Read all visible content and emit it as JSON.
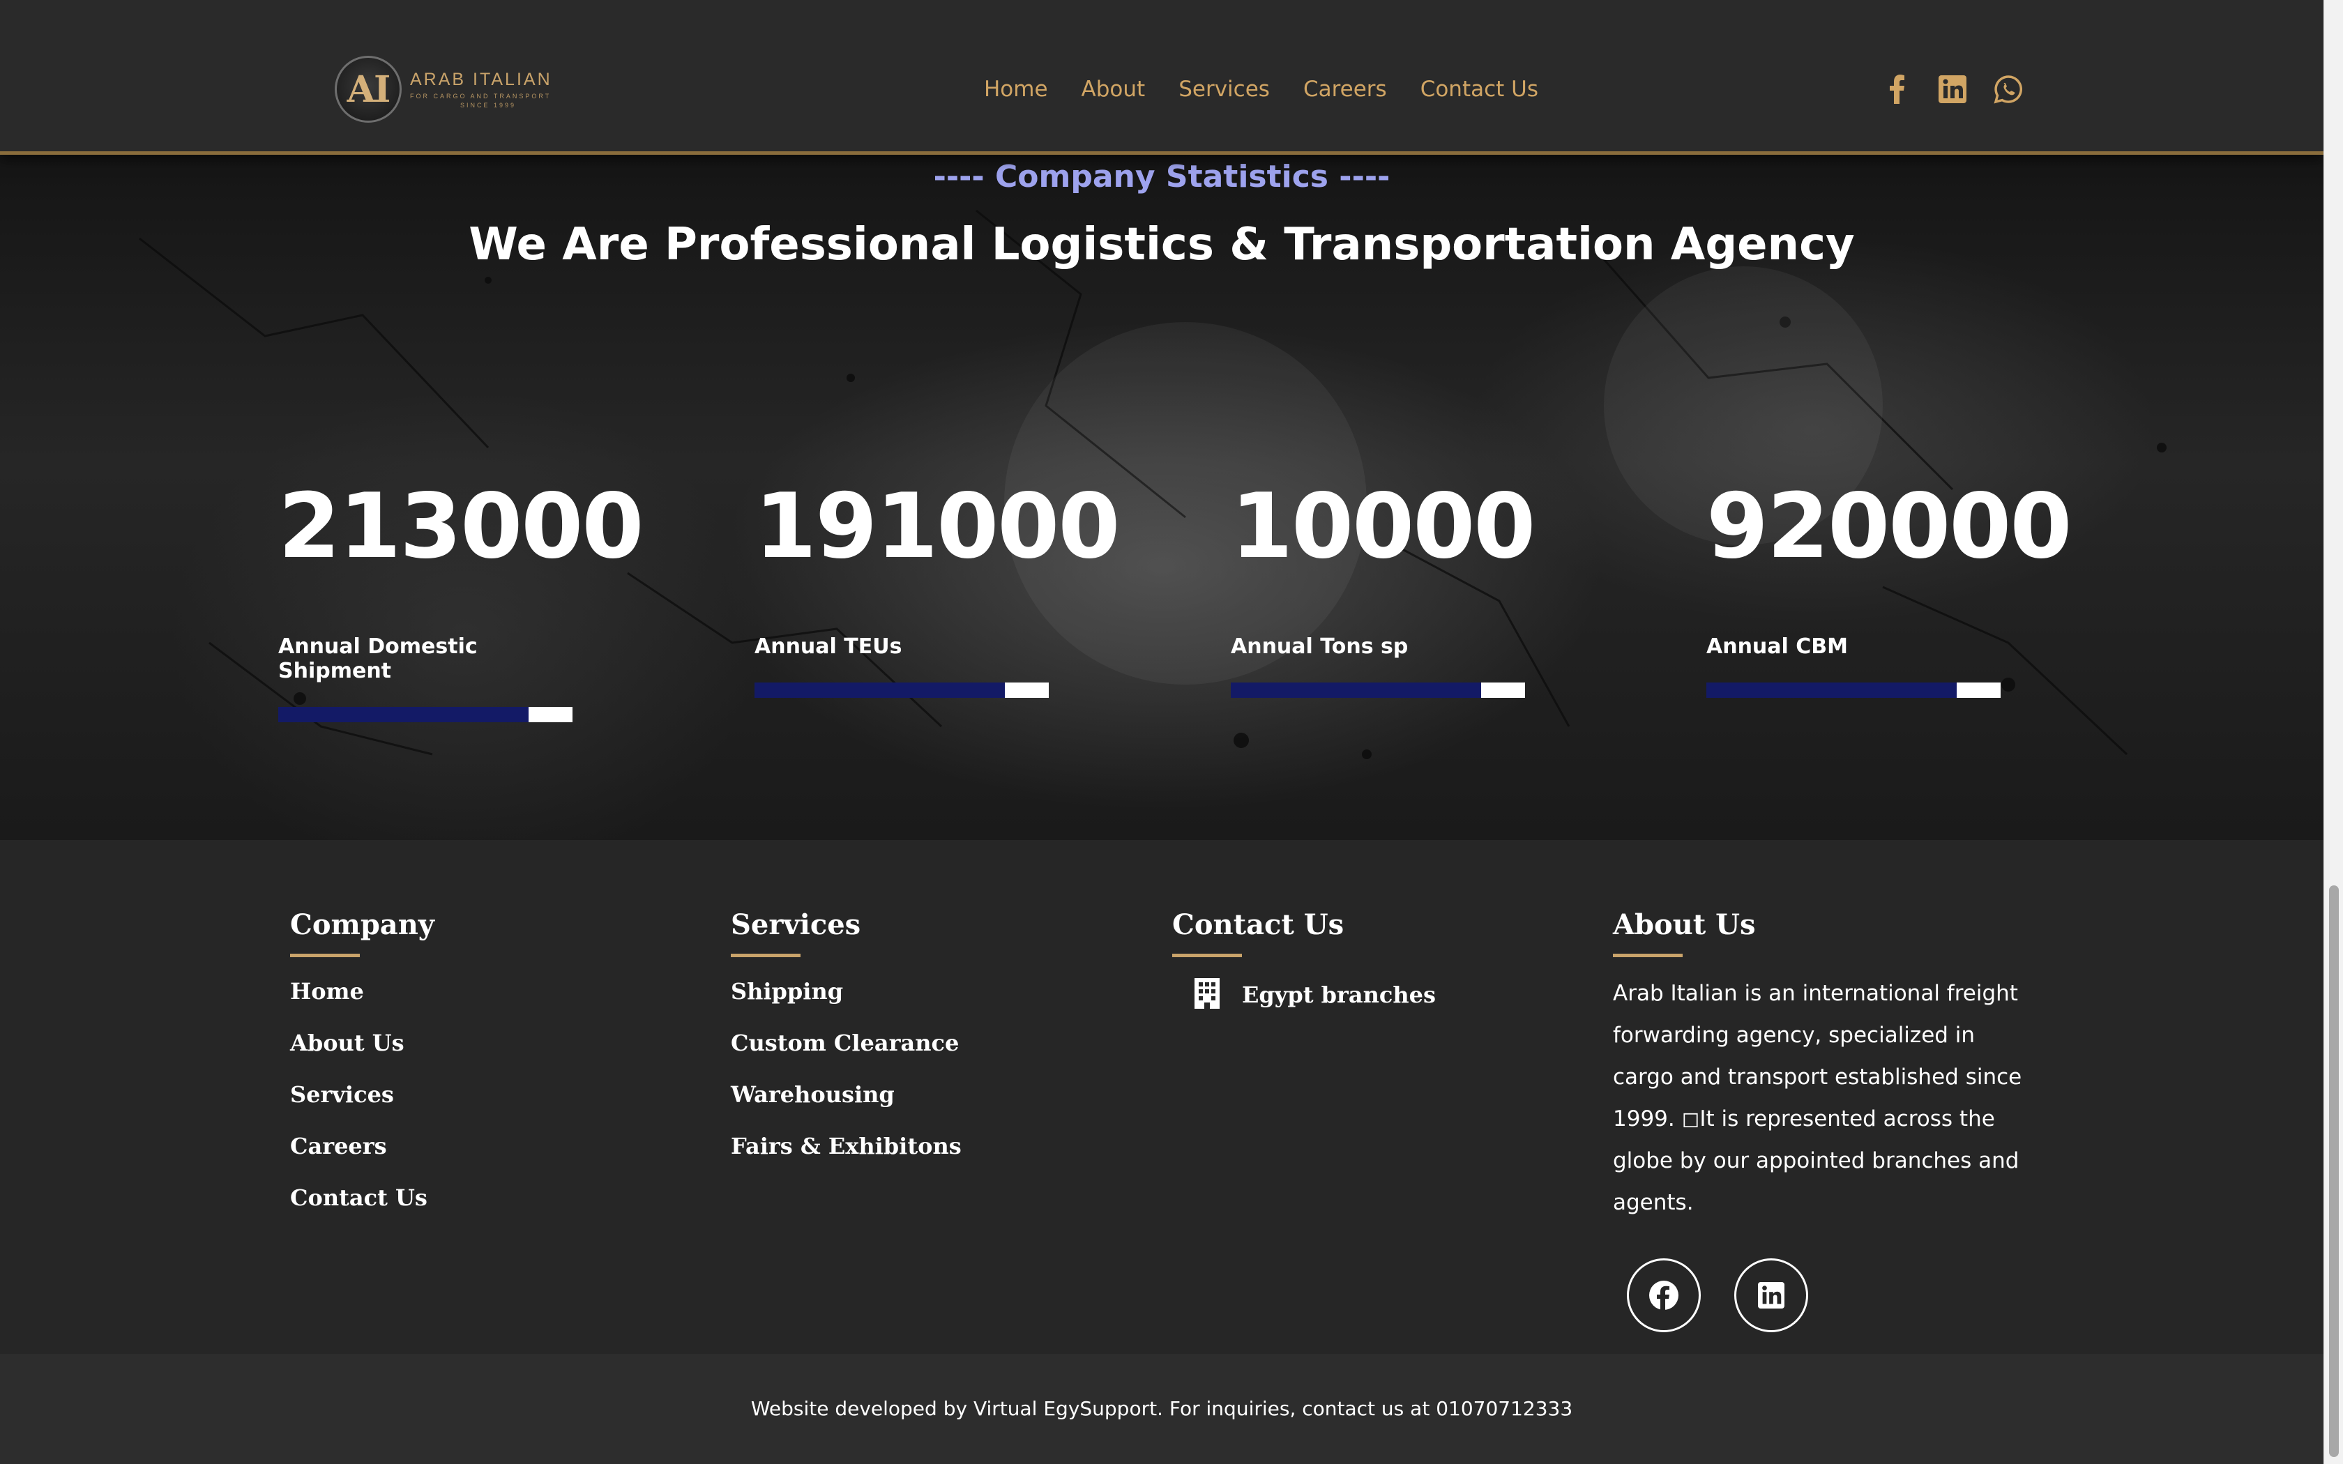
{
  "brand": {
    "logo_mark": "AI",
    "name": "ARAB ITALIAN",
    "tagline": "FOR CARGO AND TRANSPORT",
    "since": "SINCE 1999"
  },
  "nav": {
    "items": [
      "Home",
      "About",
      "Services",
      "Careers",
      "Contact Us"
    ]
  },
  "header_socials": [
    "facebook-icon",
    "linkedin-icon",
    "whatsapp-icon"
  ],
  "stats_section": {
    "kicker": "---- Company Statistics ----",
    "title": "We Are Professional Logistics & Transportation Agency",
    "items": [
      {
        "value": "213000",
        "label": "Annual Domestic Shipment",
        "progress": 0.85
      },
      {
        "value": "191000",
        "label": "Annual TEUs",
        "progress": 0.85
      },
      {
        "value": "10000",
        "label": "Annual Tons sp",
        "progress": 0.85
      },
      {
        "value": "920000",
        "label": "Annual CBM",
        "progress": 0.85
      }
    ]
  },
  "footer": {
    "company": {
      "title": "Company",
      "links": [
        "Home",
        "About Us",
        "Services",
        "Careers",
        "Contact Us"
      ]
    },
    "services": {
      "title": "Services",
      "links": [
        "Shipping",
        "Custom Clearance",
        "Warehousing",
        "Fairs & Exhibitons"
      ]
    },
    "contact": {
      "title": "Contact Us",
      "branches": "Egypt branches"
    },
    "about": {
      "title": "About Us",
      "text": "Arab Italian is an international freight forwarding agency, specialized in cargo and transport established since 1999. ◻It is represented across the globe by our appointed branches and agents."
    },
    "credit": "Website developed by Virtual EgySupport. For inquiries, contact us at 01070712333"
  },
  "colors": {
    "gold": "#d1a564",
    "accent_purple": "#9ea3ee",
    "bar_fill": "#131a66",
    "background": "#262626"
  }
}
